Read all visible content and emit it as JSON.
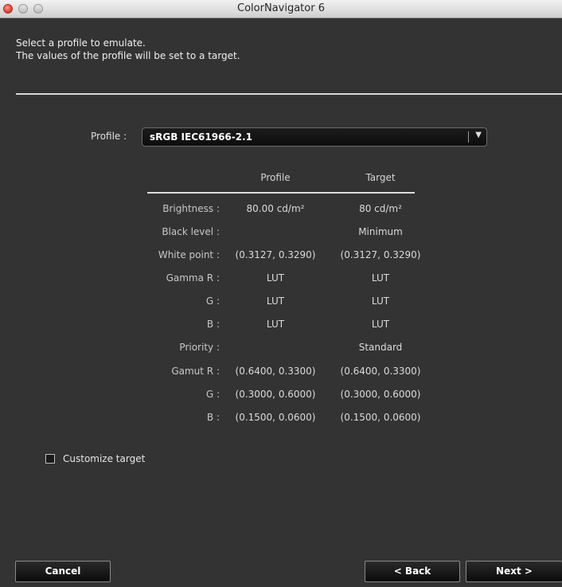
{
  "window": {
    "title": "ColorNavigator 6"
  },
  "intro": {
    "line1": "Select a profile to emulate.",
    "line2": "The values of the profile will be set to a target."
  },
  "profile": {
    "label": "Profile :",
    "selected": "sRGB IEC61966-2.1"
  },
  "table": {
    "headers": {
      "profile": "Profile",
      "target": "Target"
    },
    "rows": [
      {
        "label": "Brightness :",
        "profile": "80.00 cd/m²",
        "target": "80 cd/m²"
      },
      {
        "label": "Black level :",
        "profile": "",
        "target": "Minimum"
      },
      {
        "label": "White point :",
        "profile": "(0.3127, 0.3290)",
        "target": "(0.3127, 0.3290)"
      },
      {
        "label": "Gamma R :",
        "profile": "LUT",
        "target": "LUT"
      },
      {
        "label": "G :",
        "profile": "LUT",
        "target": "LUT"
      },
      {
        "label": "B :",
        "profile": "LUT",
        "target": "LUT"
      },
      {
        "label": "Priority :",
        "profile": "",
        "target": "Standard"
      },
      {
        "label": "Gamut R :",
        "profile": "(0.6400, 0.3300)",
        "target": "(0.6400, 0.3300)"
      },
      {
        "label": "G :",
        "profile": "(0.3000, 0.6000)",
        "target": "(0.3000, 0.6000)"
      },
      {
        "label": "B :",
        "profile": "(0.1500, 0.0600)",
        "target": "(0.1500, 0.0600)"
      }
    ]
  },
  "customize": {
    "label": "Customize target",
    "checked": false
  },
  "buttons": {
    "cancel": "Cancel",
    "back": "< Back",
    "next": "Next >"
  },
  "icons": {
    "dropdown": "chevron-down-icon"
  }
}
